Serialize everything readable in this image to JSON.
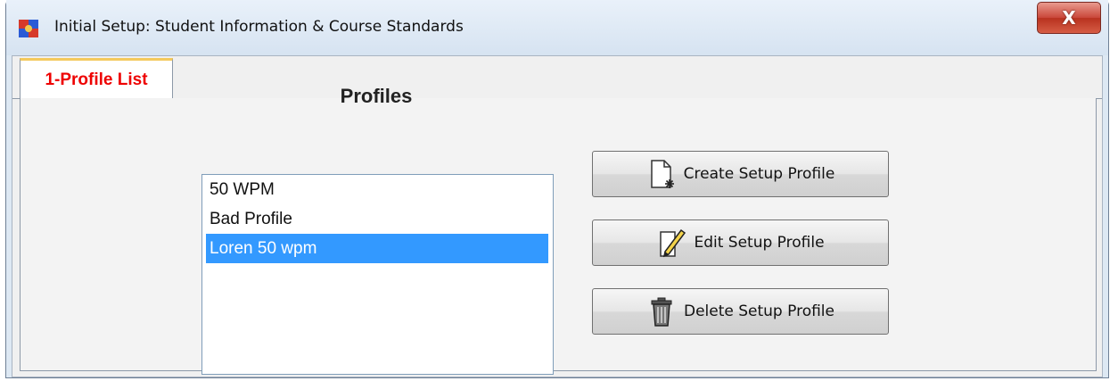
{
  "window": {
    "title": "Initial Setup: Student Information & Course Standards",
    "close_label": "X"
  },
  "tabs": [
    {
      "label": "1-Profile List",
      "active": true
    }
  ],
  "profiles": {
    "heading": "Profiles",
    "items": [
      {
        "label": "50 WPM",
        "selected": false
      },
      {
        "label": "Bad Profile",
        "selected": false
      },
      {
        "label": "Loren 50 wpm",
        "selected": true
      }
    ]
  },
  "buttons": {
    "create": {
      "label": "Create Setup Profile",
      "icon": "new-document-icon"
    },
    "edit": {
      "label": "Edit Setup Profile",
      "icon": "edit-pencil-icon"
    },
    "delete": {
      "label": "Delete Setup Profile",
      "icon": "trash-can-icon"
    }
  },
  "colors": {
    "tab_text": "#ee0000",
    "selection": "#3399ff",
    "close_button": "#c9473a"
  }
}
